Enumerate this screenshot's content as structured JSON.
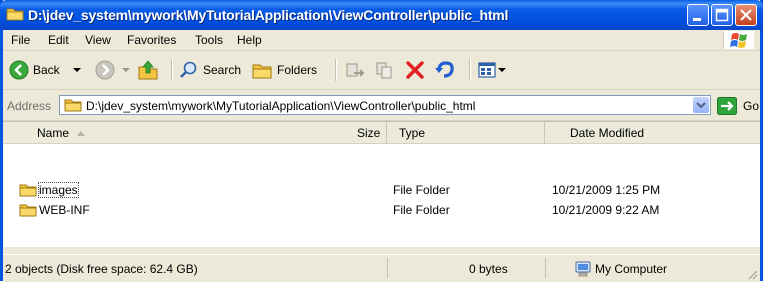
{
  "window": {
    "title": "D:\\jdev_system\\mywork\\MyTutorialApplication\\ViewController\\public_html"
  },
  "menu": [
    "File",
    "Edit",
    "View",
    "Favorites",
    "Tools",
    "Help"
  ],
  "toolbar": {
    "back_label": "Back",
    "search_label": "Search",
    "folders_label": "Folders"
  },
  "address": {
    "label": "Address",
    "value": "D:\\jdev_system\\mywork\\MyTutorialApplication\\ViewController\\public_html",
    "go_label": "Go"
  },
  "columns": {
    "name": "Name",
    "size": "Size",
    "type": "Type",
    "date": "Date Modified"
  },
  "files": [
    {
      "name": "images",
      "size": "",
      "type": "File Folder",
      "date": "10/21/2009 1:25 PM"
    },
    {
      "name": "WEB-INF",
      "size": "",
      "type": "File Folder",
      "date": "10/21/2009 9:22 AM"
    }
  ],
  "status": {
    "objects": "2 objects (Disk free space: 62.4 GB)",
    "size": "0 bytes",
    "location": "My Computer"
  },
  "colors": {
    "titlebar": "#0a5de6",
    "folder": "#f5c542",
    "go_arrow": "#2fa43a",
    "delete_x": "#e02020"
  }
}
